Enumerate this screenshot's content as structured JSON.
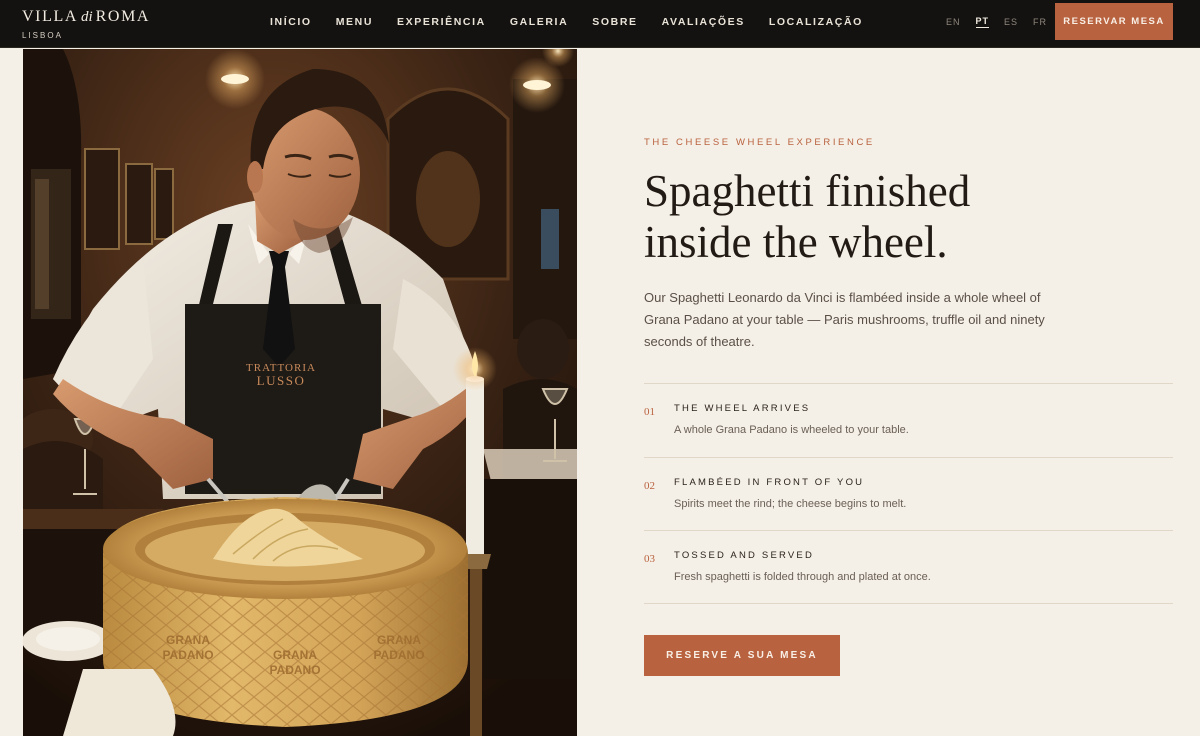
{
  "nav": {
    "brand_pre": "VILLA",
    "brand_di": "di",
    "brand_post": "ROMA",
    "brand_city": "LISBOA",
    "links": [
      "INÍCIO",
      "MENU",
      "EXPERIÊNCIA",
      "GALERIA",
      "SOBRE",
      "AVALIAÇÕES",
      "LOCALIZAÇÃO"
    ],
    "languages": [
      "EN",
      "PT",
      "ES",
      "FR"
    ],
    "active_language": "PT",
    "reserve_label": "RESERVAR MESA"
  },
  "hero": {
    "photo": {
      "apron_line1": "TRATTORIA",
      "apron_line2": "LUSSO",
      "cheese_text_1": "GRANA",
      "cheese_text_2": "PADANO"
    },
    "eyebrow": "THE CHEESE WHEEL EXPERIENCE",
    "headline_line1": "Spaghetti finished",
    "headline_line2": "inside the wheel.",
    "intro": "Our Spaghetti Leonardo da Vinci is flambéed inside a whole wheel of Grana Padano at your table — Paris mushrooms, truffle oil and ninety seconds of theatre.",
    "steps": [
      {
        "num": "01",
        "title": "THE WHEEL ARRIVES",
        "desc": "A whole Grana Padano is wheeled to your table."
      },
      {
        "num": "02",
        "title": "FLAMBÉED IN FRONT OF YOU",
        "desc": "Spirits meet the rind; the cheese begins to melt."
      },
      {
        "num": "03",
        "title": "TOSSED AND SERVED",
        "desc": "Fresh spaghetti is folded through and plated at once."
      }
    ],
    "cta_label": "RESERVE A SUA MESA"
  },
  "colors": {
    "accent": "#b9623f",
    "background": "#f5f0e7",
    "nav_background": "#141210"
  }
}
